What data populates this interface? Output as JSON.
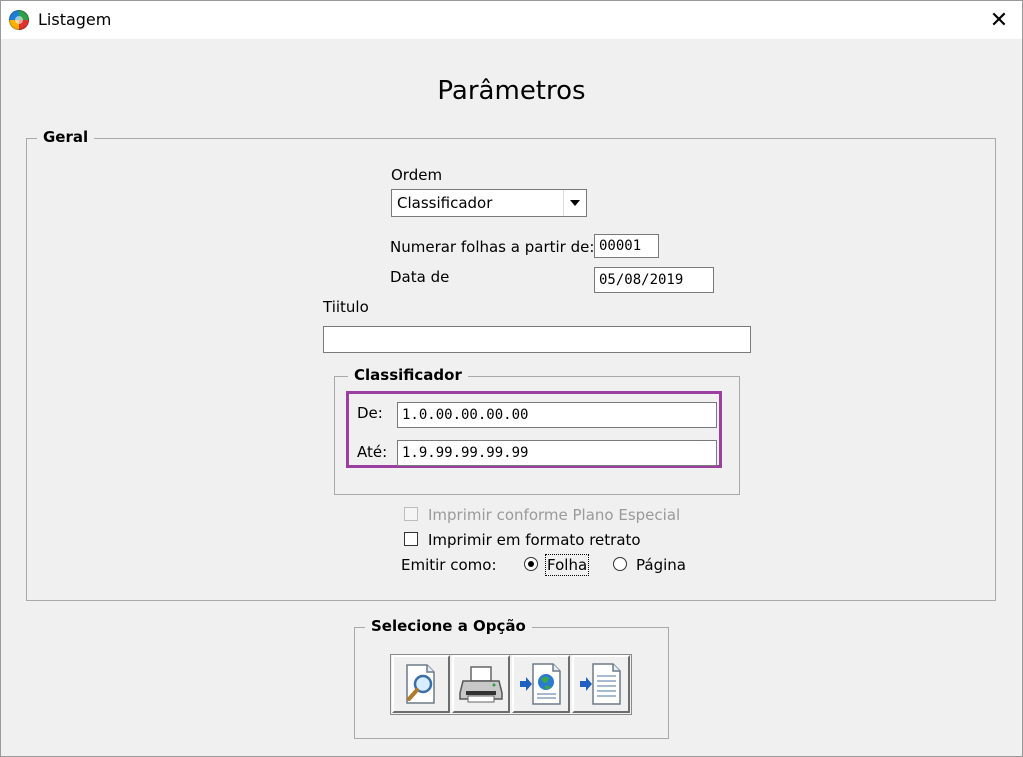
{
  "window": {
    "title": "Listagem",
    "close_glyph": "✕"
  },
  "heading": "Parâmetros",
  "geral": {
    "legend": "Geral",
    "ordem_label": "Ordem",
    "ordem_value": "Classificador",
    "numerar_label": "Numerar folhas a partir de:",
    "numerar_value": "00001",
    "data_label": "Data de",
    "data_value": "05/08/2019",
    "titulo_label": "Tiitulo",
    "titulo_value": ""
  },
  "classificador": {
    "legend": "Classificador",
    "de_label": "De:",
    "de_value": "1.0.00.00.00.00",
    "ate_label": "Até:",
    "ate_value": "1.9.99.99.99.99",
    "highlight_color": "#9b3fa0"
  },
  "options": {
    "plano_especial_label": "Imprimir conforme Plano Especial",
    "plano_especial_checked": false,
    "plano_especial_enabled": false,
    "retrato_label": "Imprimir em formato retrato",
    "retrato_checked": false,
    "emitir_label": "Emitir como:",
    "folha_label": "Folha",
    "folha_selected": true,
    "pagina_label": "Página",
    "pagina_selected": false
  },
  "selecione": {
    "legend": "Selecione a Opção",
    "buttons": [
      {
        "icon": "preview-magnifier-icon"
      },
      {
        "icon": "printer-icon"
      },
      {
        "icon": "export-web-icon"
      },
      {
        "icon": "export-document-icon"
      }
    ]
  }
}
